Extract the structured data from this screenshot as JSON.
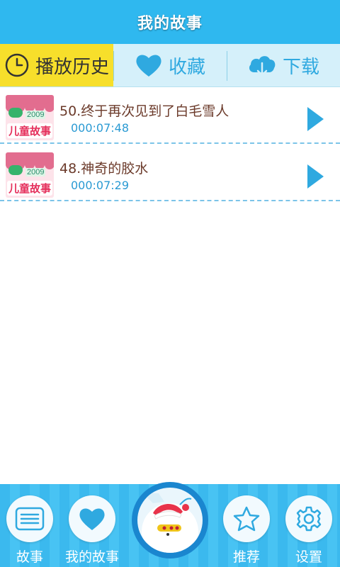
{
  "header": {
    "title": "我的故事"
  },
  "tabs": [
    {
      "label": "播放历史",
      "icon": "clock-icon"
    },
    {
      "label": "收藏",
      "icon": "heart-icon"
    },
    {
      "label": "下载",
      "icon": "cloud-download-icon"
    }
  ],
  "stories": [
    {
      "title": "50.终于再次见到了白毛雪人",
      "duration": "000:07:48",
      "thumb_badge": "2009",
      "thumb_text": "儿童故事"
    },
    {
      "title": "48.神奇的胶水",
      "duration": "000:07:29",
      "thumb_badge": "2009",
      "thumb_text": "儿童故事"
    }
  ],
  "bottom_nav": [
    {
      "label": "故事",
      "icon": "book-list-icon"
    },
    {
      "label": "我的故事",
      "icon": "heart-icon"
    },
    {
      "label": "",
      "icon": "snowman-player-icon"
    },
    {
      "label": "推荐",
      "icon": "star-icon"
    },
    {
      "label": "设置",
      "icon": "gear-icon"
    }
  ],
  "colors": {
    "header": "#2fb8ef",
    "active_tab": "#f7df2b",
    "accent": "#2a9ad3",
    "title_text": "#6b3a2a"
  }
}
